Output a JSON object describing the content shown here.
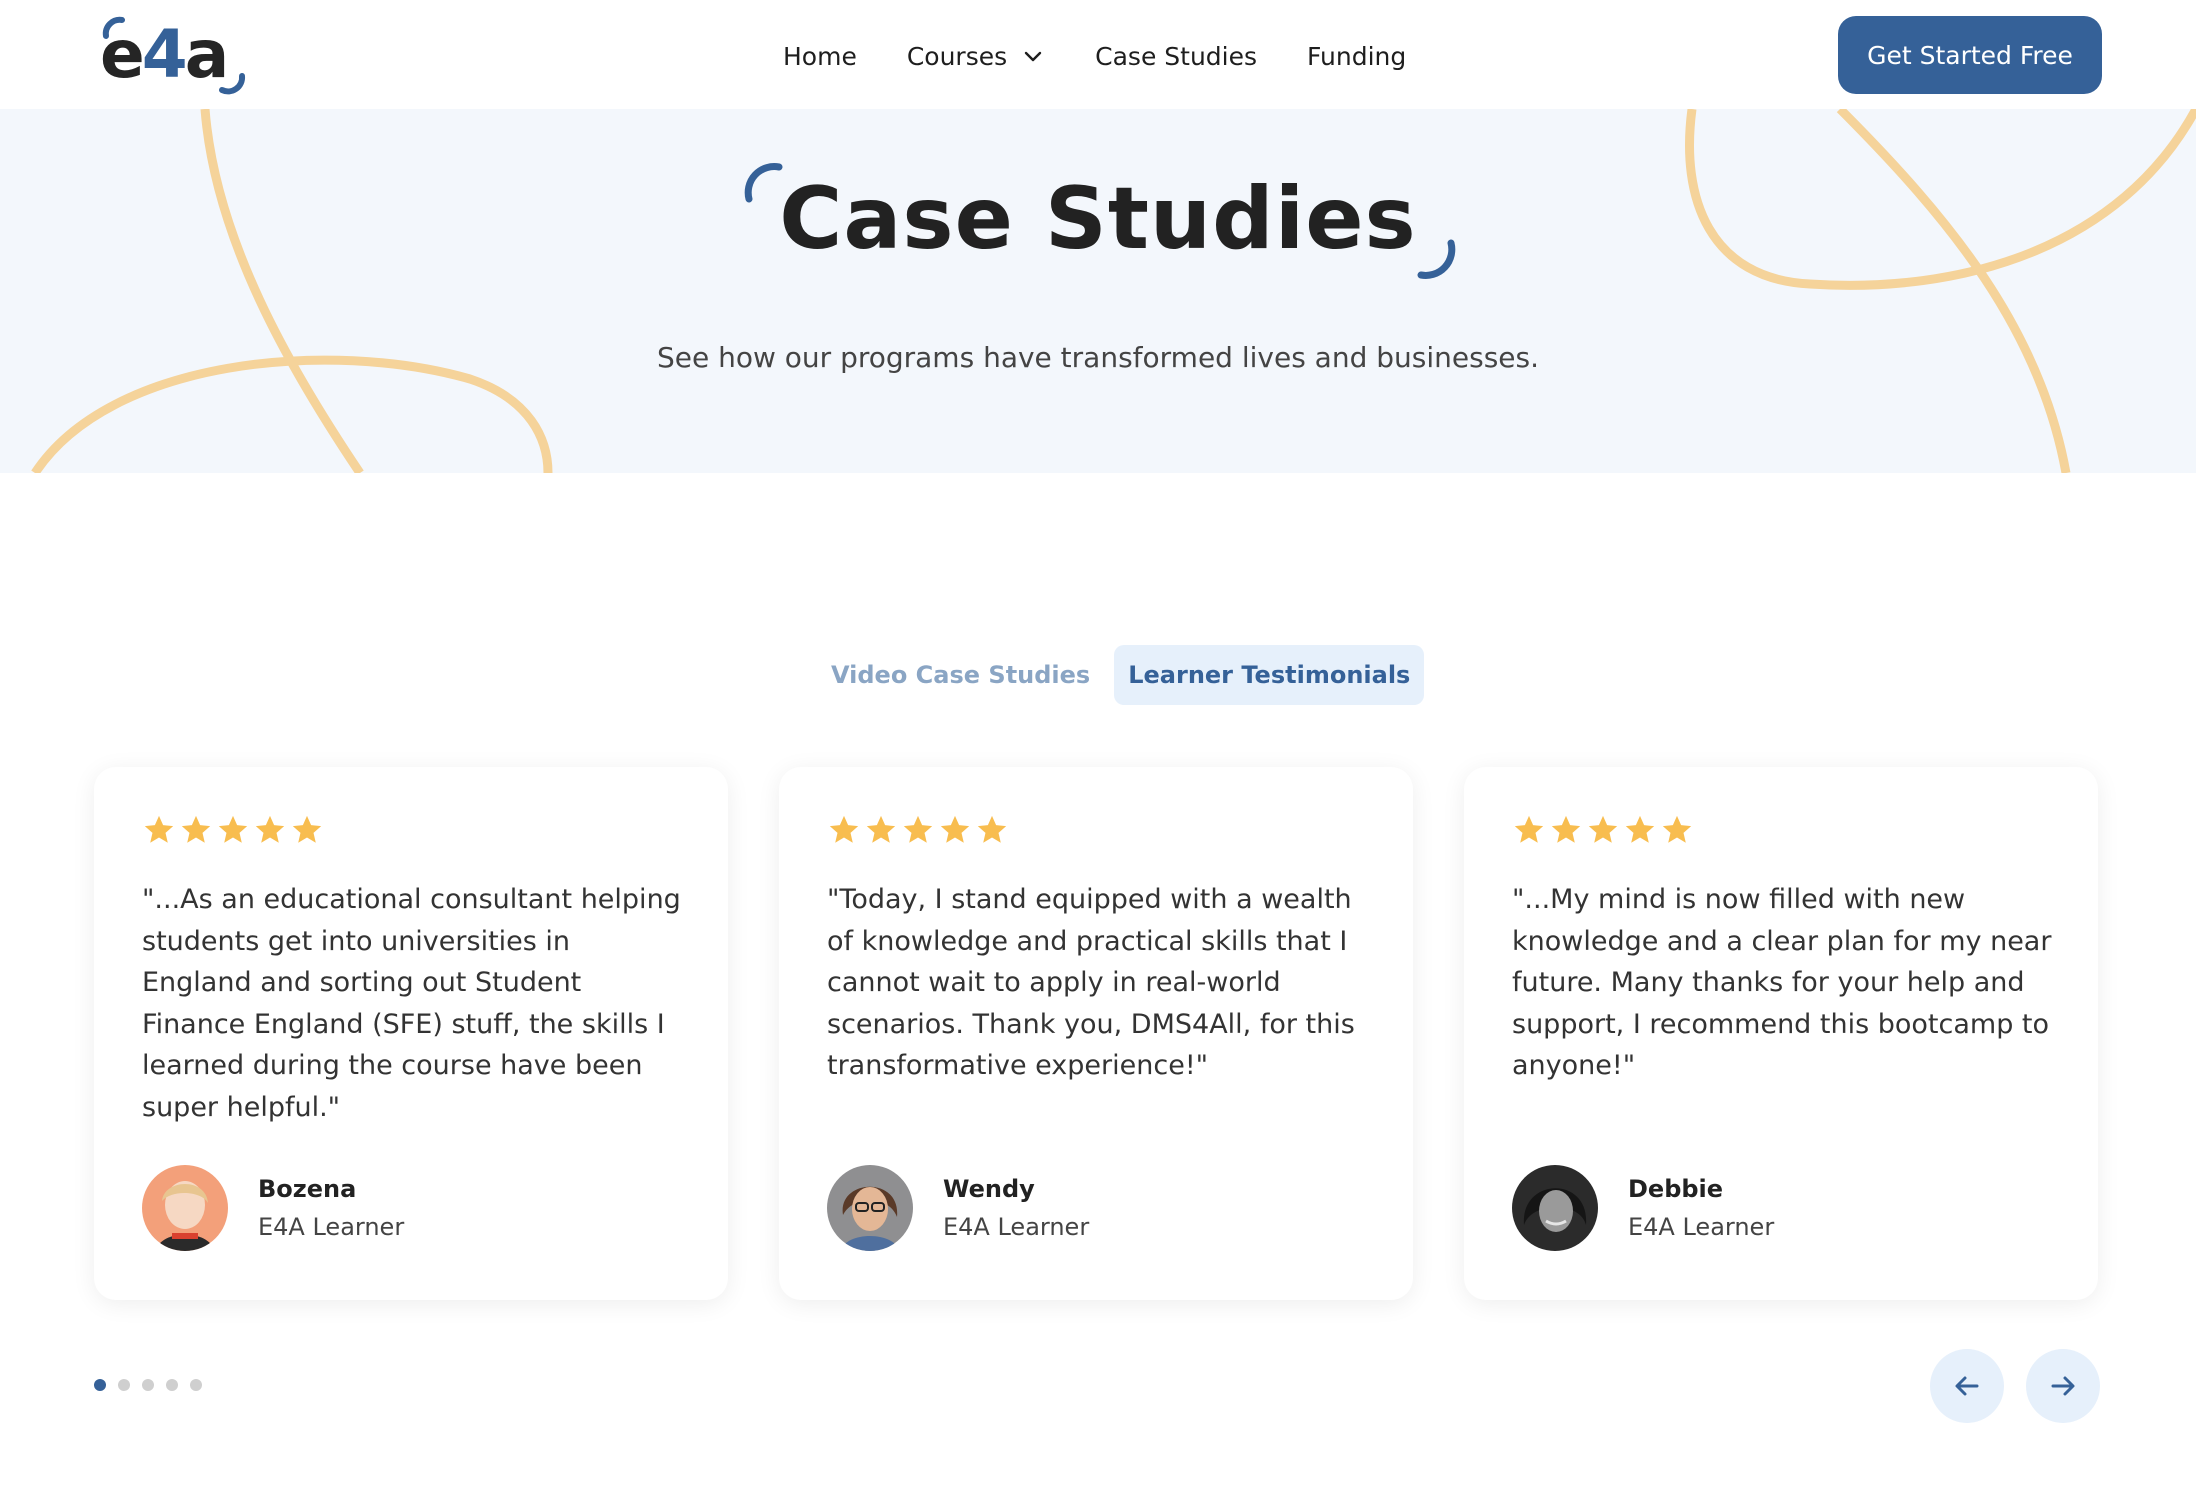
{
  "colors": {
    "brand": "#356198",
    "accent": "#f5d39a",
    "star": "#f8bd4f",
    "hero_bg": "#f3f7fc"
  },
  "logo": {
    "text_left": "e",
    "text_num": "4",
    "text_right": "a"
  },
  "nav": {
    "links": [
      {
        "label": "Home"
      },
      {
        "label": "Courses",
        "icon": "chevron-down-icon"
      },
      {
        "label": "Case Studies"
      },
      {
        "label": "Funding"
      }
    ],
    "cta_label": "Get Started Free"
  },
  "hero": {
    "title": "Case Studies",
    "subtitle": "See how our programs have transformed lives and businesses."
  },
  "tabs": [
    {
      "label": "Video Case Studies",
      "active": false
    },
    {
      "label": "Learner Testimonials",
      "active": true
    }
  ],
  "testimonials": [
    {
      "rating": 5,
      "quote": "\"...As an educational consultant helping  students get into universities in England and sorting out Student Finance England (SFE) stuff, the skills I learned during the course have been super helpful.\"",
      "name": "Bozena",
      "role": "E4A Learner"
    },
    {
      "rating": 5,
      "quote": "\"Today, I stand equipped with a wealth of knowledge and practical skills that I cannot wait to apply in real-world scenarios. Thank you, DMS4All, for this transformative experience!\"",
      "name": "Wendy",
      "role": "E4A Learner"
    },
    {
      "rating": 5,
      "quote": "\"...My mind is now filled with new knowledge and a clear plan for my near future. Many thanks for your help and support, I recommend this bootcamp to anyone!\"",
      "name": "Debbie",
      "role": "E4A Learner"
    }
  ],
  "pagination": {
    "total": 5,
    "current": 1
  },
  "controls": {
    "prev_icon": "arrow-left-icon",
    "next_icon": "arrow-right-icon"
  }
}
